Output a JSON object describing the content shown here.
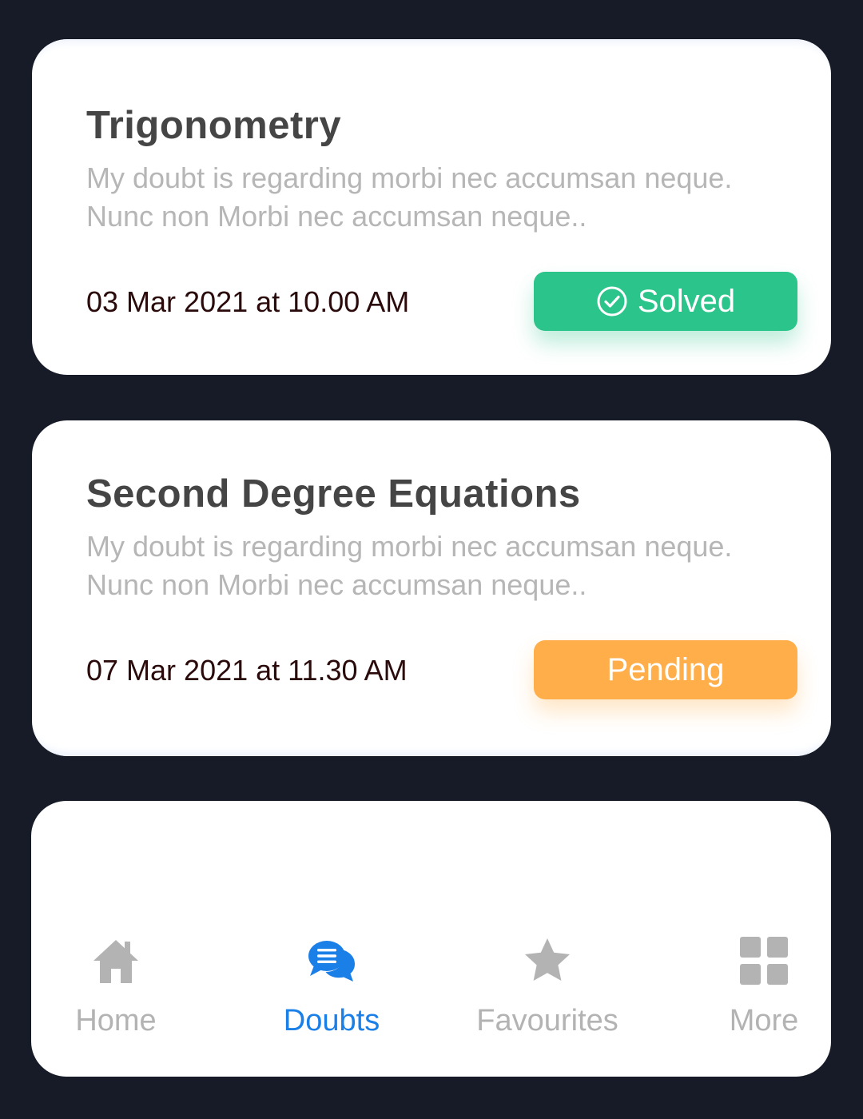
{
  "doubts": [
    {
      "title": "Trigonometry",
      "description": "My doubt is regarding morbi nec accumsan neque. Nunc non Morbi nec accumsan neque..",
      "date": "03 Mar 2021 at 10.00 AM",
      "status": "Solved",
      "status_color": "#2bc48a"
    },
    {
      "title": "Second Degree Equations",
      "description": "My doubt is regarding morbi nec accumsan neque. Nunc non Morbi nec accumsan neque..",
      "date": "07 Mar 2021 at 11.30 AM",
      "status": "Pending",
      "status_color": "#ffae4a"
    }
  ],
  "nav": {
    "items": [
      {
        "label": "Home",
        "icon": "home-icon",
        "active": false
      },
      {
        "label": "Doubts",
        "icon": "chat-bubbles-icon",
        "active": true
      },
      {
        "label": "Favourites",
        "icon": "star-icon",
        "active": false
      },
      {
        "label": "More",
        "icon": "grid-icon",
        "active": false
      }
    ],
    "active_color": "#1b7fe8",
    "inactive_color": "#b3b3b3"
  },
  "colors": {
    "background": "#161b27",
    "card": "#ffffff"
  }
}
